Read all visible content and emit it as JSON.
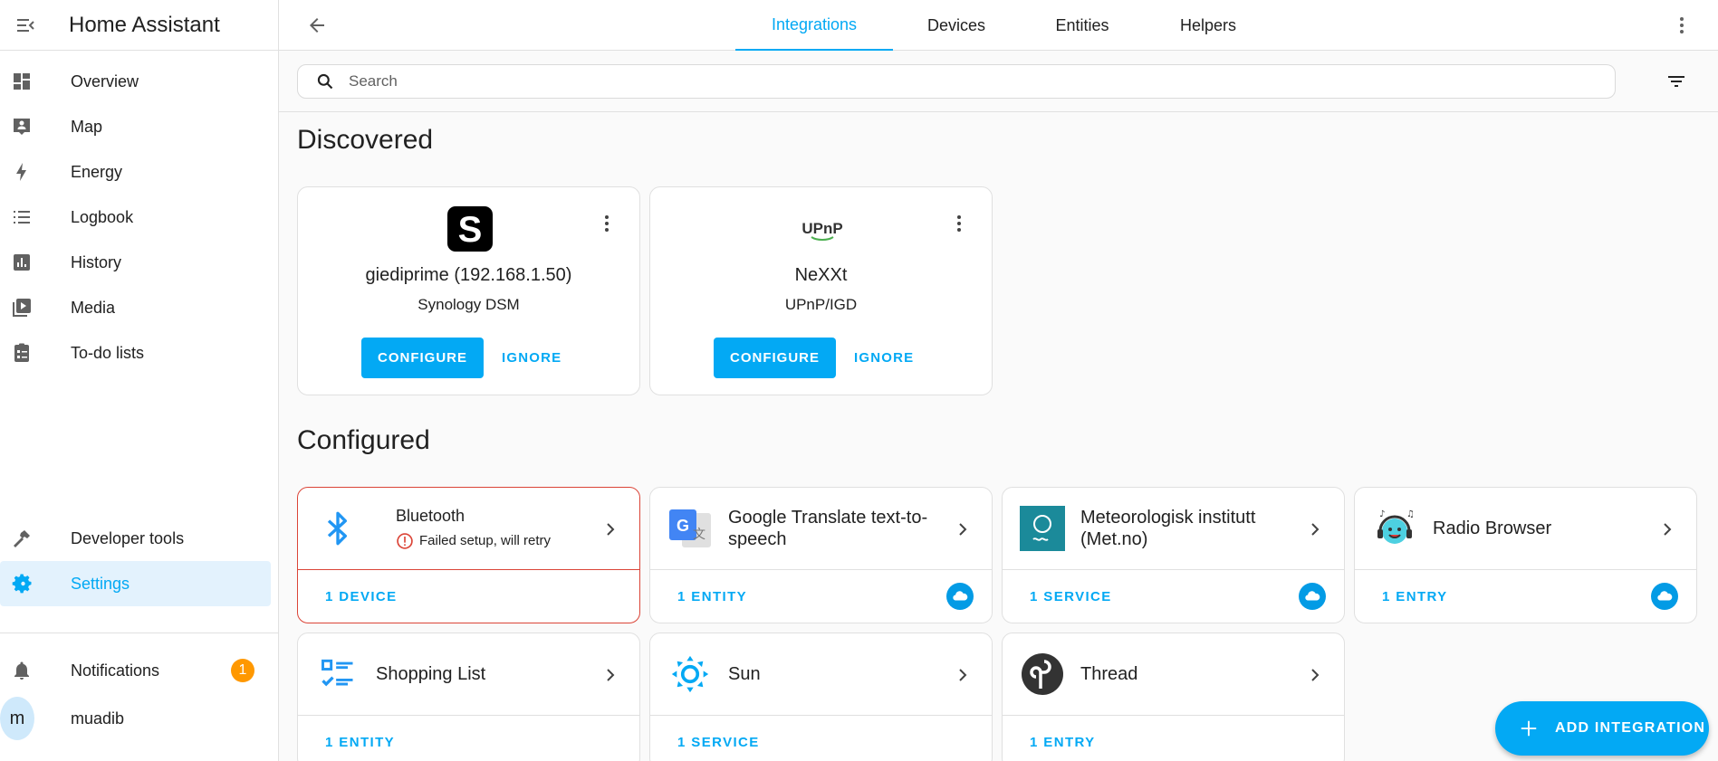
{
  "app": {
    "title": "Home Assistant"
  },
  "sidebar": {
    "items": [
      {
        "label": "Overview",
        "icon": "dashboard-icon"
      },
      {
        "label": "Map",
        "icon": "map-icon"
      },
      {
        "label": "Energy",
        "icon": "lightning-icon"
      },
      {
        "label": "Logbook",
        "icon": "list-icon"
      },
      {
        "label": "History",
        "icon": "chart-icon"
      },
      {
        "label": "Media",
        "icon": "media-icon"
      },
      {
        "label": "To-do lists",
        "icon": "clipboard-icon"
      }
    ],
    "developer_tools": "Developer tools",
    "settings": "Settings",
    "notifications": "Notifications",
    "notification_count": "1",
    "user_initial": "m",
    "user_name": "muadib"
  },
  "tabs": [
    {
      "label": "Integrations",
      "active": true
    },
    {
      "label": "Devices",
      "active": false
    },
    {
      "label": "Entities",
      "active": false
    },
    {
      "label": "Helpers",
      "active": false
    }
  ],
  "search": {
    "placeholder": "Search"
  },
  "discovered": {
    "title": "Discovered",
    "cards": [
      {
        "name": "giediprime (192.168.1.50)",
        "integration": "Synology DSM",
        "configure": "CONFIGURE",
        "ignore": "IGNORE"
      },
      {
        "name": "NeXXt",
        "integration": "UPnP/IGD",
        "logo_text": "UPnP",
        "configure": "CONFIGURE",
        "ignore": "IGNORE"
      }
    ]
  },
  "configured": {
    "title": "Configured",
    "cards": [
      {
        "title": "Bluetooth",
        "status": "Failed setup, will retry",
        "footer": "1 DEVICE"
      },
      {
        "title": "Google Translate text-to-speech",
        "footer": "1 ENTITY",
        "cloud": true
      },
      {
        "title": "Meteorologisk institutt (Met.no)",
        "footer": "1 SERVICE",
        "cloud": true
      },
      {
        "title": "Radio Browser",
        "footer": "1 ENTRY",
        "cloud": true
      },
      {
        "title": "Shopping List",
        "footer": "1 ENTITY"
      },
      {
        "title": "Sun",
        "footer": "1 SERVICE"
      },
      {
        "title": "Thread",
        "footer": "1 ENTRY"
      }
    ]
  },
  "fab": {
    "label": "ADD INTEGRATION"
  },
  "colors": {
    "accent": "#03a9f4",
    "error": "#db4437",
    "badge": "#ff9800"
  }
}
